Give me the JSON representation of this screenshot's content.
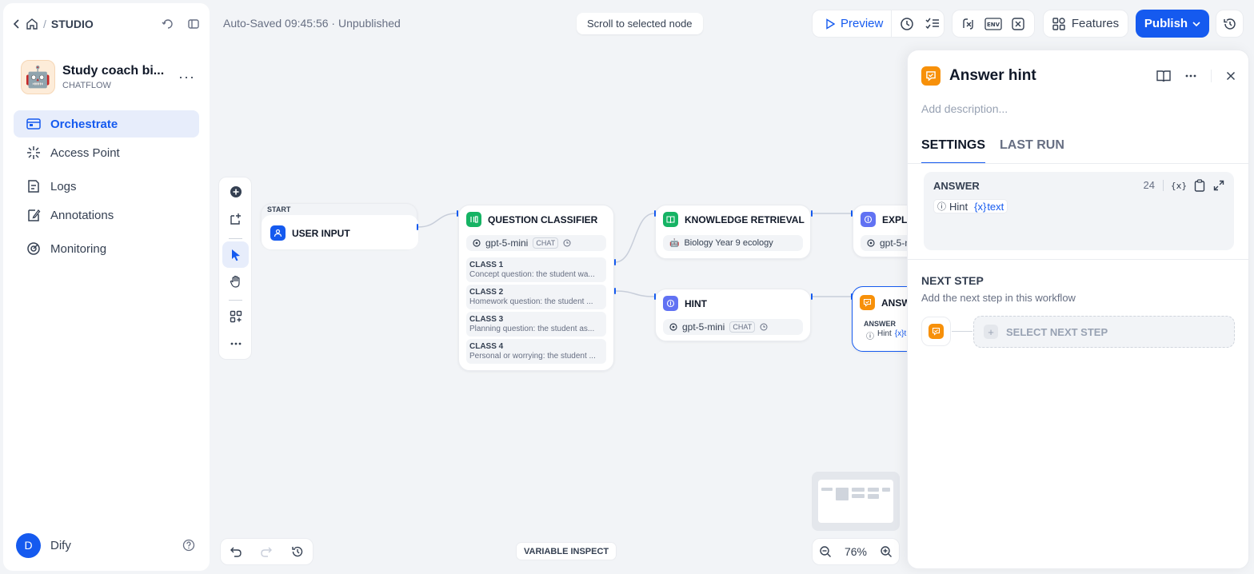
{
  "sidebar": {
    "breadcrumb": "STUDIO",
    "app": {
      "name": "Study coach bi...",
      "type": "CHATFLOW",
      "avatar": "🤖"
    },
    "nav": [
      {
        "label": "Orchestrate",
        "icon": "orchestrate-icon",
        "active": true
      },
      {
        "label": "Access Point",
        "icon": "access-point-icon"
      },
      {
        "label": "Logs",
        "icon": "logs-icon"
      },
      {
        "label": "Annotations",
        "icon": "annotations-icon"
      },
      {
        "label": "Monitoring",
        "icon": "monitoring-icon"
      }
    ],
    "user": {
      "initial": "D",
      "name": "Dify"
    }
  },
  "topbar": {
    "status": "Auto-Saved 09:45:56 · Unpublished",
    "scroll_to_node": "Scroll to selected node",
    "preview": "Preview",
    "features": "Features",
    "publish": "Publish"
  },
  "canvas": {
    "start_label": "START",
    "user_input": "USER INPUT",
    "classifier": {
      "title": "QUESTION CLASSIFIER",
      "model": "gpt-5-mini",
      "model_tag": "CHAT",
      "classes": [
        {
          "title": "CLASS 1",
          "desc": "Concept question: the student wa..."
        },
        {
          "title": "CLASS 2",
          "desc": "Homework question: the student ..."
        },
        {
          "title": "CLASS 3",
          "desc": "Planning question: the student as..."
        },
        {
          "title": "CLASS 4",
          "desc": "Personal or worrying: the student ..."
        }
      ]
    },
    "knowledge": {
      "title": "KNOWLEDGE RETRIEVAL",
      "dataset": "Biology Year 9 ecology"
    },
    "hint": {
      "title": "HINT",
      "model": "gpt-5-mini",
      "model_tag": "CHAT"
    },
    "explain": {
      "title": "EXPLA",
      "model": "gpt-5-m"
    },
    "answer": {
      "title": "ANSW",
      "label": "ANSWER",
      "var": "Hint",
      "var_prefix": "{x}",
      "var_name": "t"
    },
    "zoom": "76%",
    "variable_inspect": "VARIABLE INSPECT"
  },
  "panel": {
    "title": "Answer hint",
    "description_placeholder": "Add description...",
    "tabs": [
      {
        "label": "SETTINGS",
        "active": true
      },
      {
        "label": "LAST RUN"
      }
    ],
    "answer": {
      "label": "ANSWER",
      "count": "24",
      "var_node": "Hint",
      "var_prefix": "{x}",
      "var_name": "text"
    },
    "next_step": {
      "title": "NEXT STEP",
      "desc": "Add the next step in this workflow",
      "select": "SELECT NEXT STEP"
    }
  },
  "colors": {
    "accent": "#155aef",
    "answer": "#f79009",
    "llm": "#6172f3",
    "knowledge": "#16b364"
  }
}
